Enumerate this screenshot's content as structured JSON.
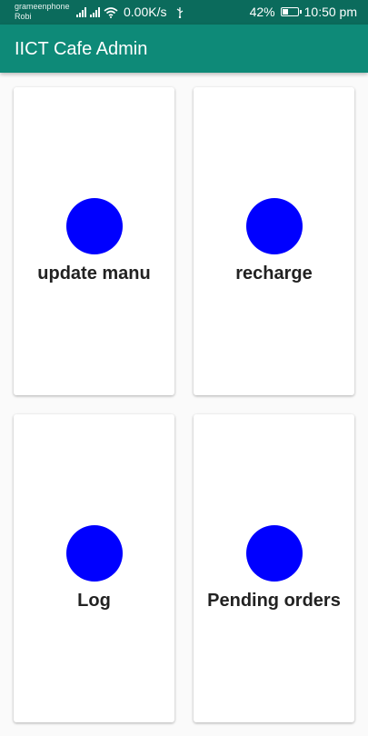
{
  "status_bar": {
    "carrier_1": "grameenphone",
    "carrier_2": "Robi",
    "net_speed": "0.00K/s",
    "battery_percent": "42%",
    "battery_level": 0.42,
    "time": "10:50 pm",
    "icons": [
      "signal-icon",
      "signal-icon",
      "wifi-icon",
      "usb-icon",
      "battery-charging-icon"
    ]
  },
  "app_bar": {
    "title": "IICT Cafe Admin",
    "background_color": "#0e8a78",
    "status_bar_color": "#0b6b5c"
  },
  "dashboard": {
    "accent_color": "#0000ff",
    "cards": [
      {
        "label": "update manu"
      },
      {
        "label": "recharge"
      },
      {
        "label": "Log"
      },
      {
        "label": "Pending orders"
      }
    ]
  }
}
